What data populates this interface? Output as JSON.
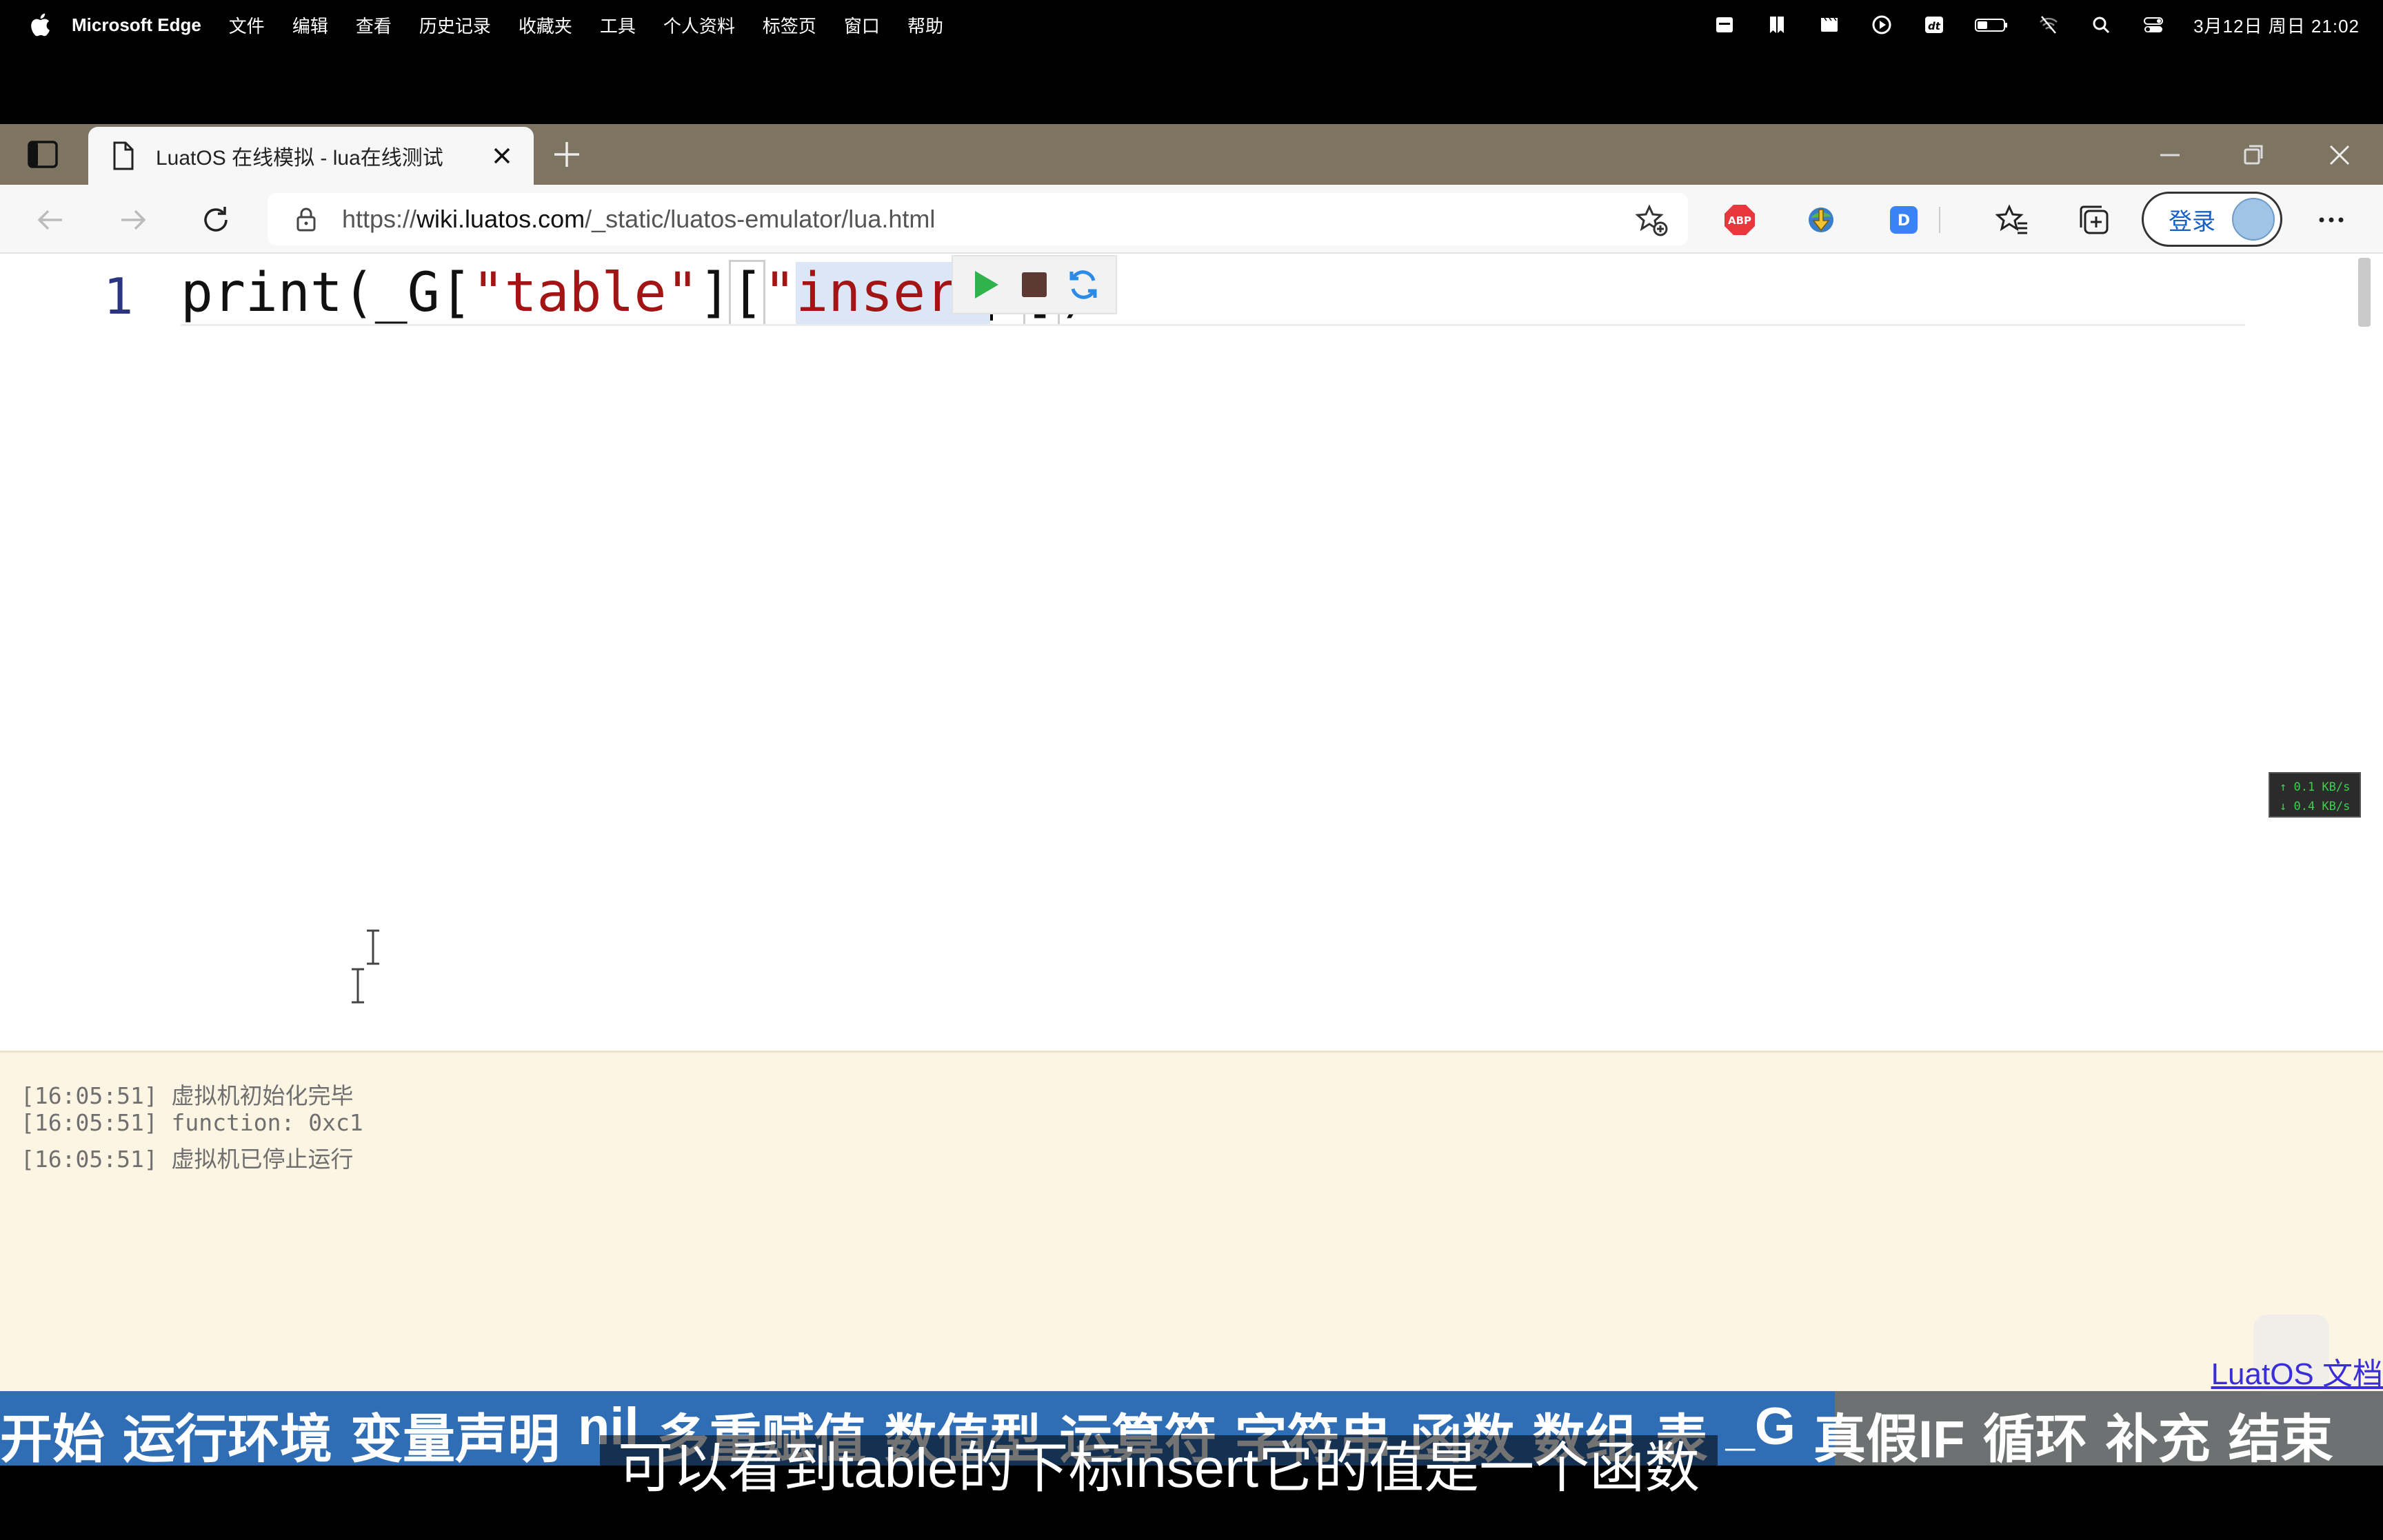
{
  "menubar": {
    "app_name": "Microsoft Edge",
    "menus": [
      "文件",
      "编辑",
      "查看",
      "历史记录",
      "收藏夹",
      "工具",
      "个人资料",
      "标签页",
      "窗口",
      "帮助"
    ],
    "clock": "3月12日 周日 21:02"
  },
  "browser": {
    "tab_title": "LuatOS 在线模拟 - lua在线测试",
    "url_prefix": "https://",
    "url_host": "wiki.luatos.com",
    "url_path": "/_static/luatos-emulator/lua.html",
    "login_label": "登录",
    "abp_label": "ABP"
  },
  "editor": {
    "line_number": "1",
    "code": {
      "p1": "print(_G[",
      "s1": "\"table\"",
      "p2": "]",
      "b1": "[",
      "s2a": "\"",
      "s2b": "insert",
      "s2c": "\"",
      "b2": "]",
      "p3": ")"
    }
  },
  "netspeed": {
    "up": "↑ 0.1 KB/s",
    "down": "↓ 0.4 KB/s"
  },
  "console": {
    "lines": [
      "[16:05:51] 虚拟机初始化完毕",
      "[16:05:51] function: 0xc1",
      "[16:05:51] 虚拟机已停止运行"
    ],
    "doc_link": "LuatOS 文档"
  },
  "chapters": {
    "items": [
      "开始",
      "运行环境",
      "变量声明",
      "nil",
      "多重赋值",
      "数值型",
      "运算符",
      "字符串",
      "函数",
      "数组",
      "表",
      "_G",
      "真假IF",
      "循环",
      "补充",
      "结束"
    ],
    "progress": 0.77
  },
  "subtitle": "可以看到table的下标insert它的值是一个函数",
  "colors": {
    "tabstrip": "#7d7461",
    "console_bg": "#fdf5e4",
    "chapter_done": "#2f6db5",
    "chapter_rest": "#6e7172"
  }
}
